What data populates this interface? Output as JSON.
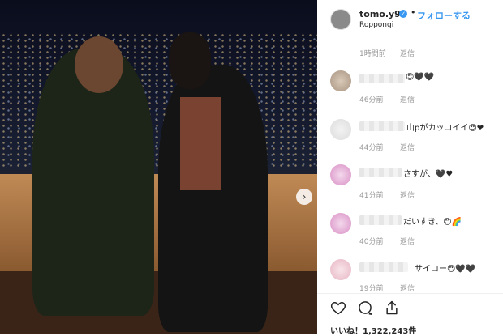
{
  "post": {
    "username": "tomo.y9",
    "follow_label": "フォローする",
    "location": "Roppongi",
    "separator": "•",
    "likes_text": "いいね！1,322,243件"
  },
  "comments": [
    {
      "text": "",
      "time": "1時間前",
      "reply": "返信"
    },
    {
      "text": "😍🖤🖤",
      "time": "46分前",
      "reply": "返信"
    },
    {
      "text": "山pがカッコイイ😍❤",
      "time": "44分前",
      "reply": "返信"
    },
    {
      "text": "さすが、🖤♥",
      "time": "41分前",
      "reply": "返信"
    },
    {
      "text": "だいすき、😊🌈",
      "time": "40分前",
      "reply": "返信"
    },
    {
      "text": "サイコー😍🖤🖤",
      "time": "19分前",
      "reply": "返信"
    }
  ],
  "icons": {
    "heart": "heart-icon",
    "comment": "comment-icon",
    "share": "share-icon"
  }
}
